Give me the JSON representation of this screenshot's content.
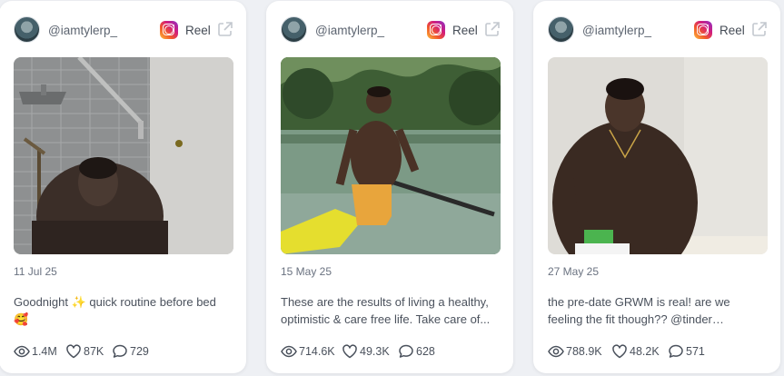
{
  "cards": [
    {
      "handle": "@iamtylerp_",
      "platform_icon": "instagram-icon",
      "type_label": "Reel",
      "date": "11 Jul 25",
      "caption": "Goodnight ✨ quick routine before bed 🥰",
      "views": "1.4M",
      "likes": "87K",
      "comments": "729"
    },
    {
      "handle": "@iamtylerp_",
      "platform_icon": "instagram-icon",
      "type_label": "Reel",
      "date": "15 May 25",
      "caption": "These are the results of living a healthy, optimistic & care free life. Take care of...",
      "views": "714.6K",
      "likes": "49.3K",
      "comments": "628"
    },
    {
      "handle": "@iamtylerp_",
      "platform_icon": "instagram-icon",
      "type_label": "Reel",
      "date": "27 May 25",
      "caption": "the pre-date GRWM is real! are we feeling the fit though?? @tinder #tinderpartner",
      "views": "788.9K",
      "likes": "48.2K",
      "comments": "571"
    }
  ]
}
